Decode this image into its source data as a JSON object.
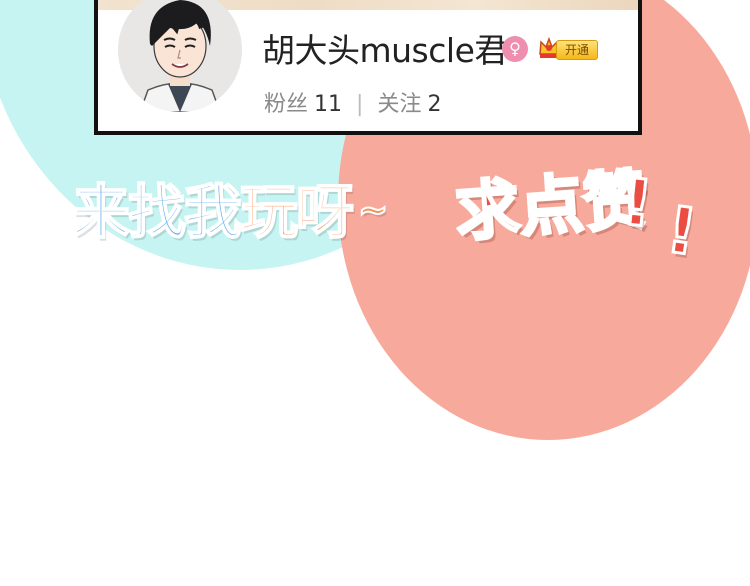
{
  "profile": {
    "username": "胡大头muscle君",
    "gender_symbol": "♀",
    "gender_icon": "female-icon",
    "vip_label": "开通",
    "fans_label": "粉丝",
    "fans_count": "11",
    "separator": "|",
    "following_label": "关注",
    "following_count": "2"
  },
  "slogans": {
    "left_blue": "来找我",
    "left_orange": "玩呀",
    "left_tilde": "~",
    "right_1": "求点赞",
    "right_2": "!",
    "right_3": "!"
  },
  "colors": {
    "cyan_circle": "#c5f4f2",
    "salmon_circle": "#f7aa9c",
    "slogan_blue": "#5aa8ec",
    "slogan_orange": "#f3935e",
    "slogan_red": "#ec4d43"
  }
}
